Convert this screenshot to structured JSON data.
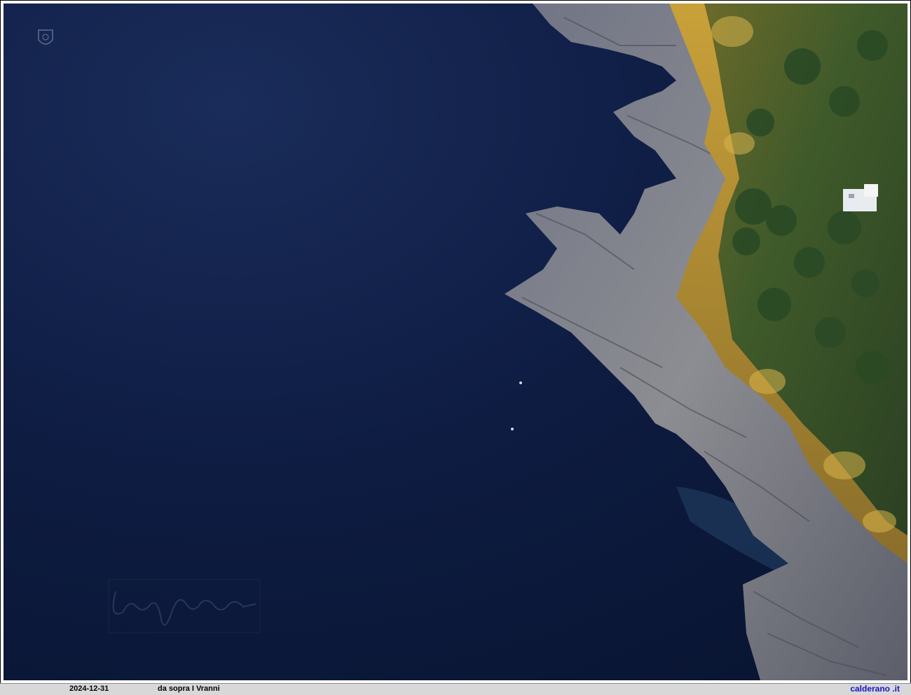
{
  "photo": {
    "subject": "aerial coastline",
    "sea_color": "#0b1733",
    "watermark_signature": "Calderano signature",
    "watermark_logo": "shield-logo"
  },
  "footer": {
    "date": "2024-12-31",
    "caption": "da sopra I Vranni",
    "site": "calderano .it"
  },
  "colors": {
    "footer_bg": "#d8d8d8",
    "site_link": "#1515c8"
  }
}
